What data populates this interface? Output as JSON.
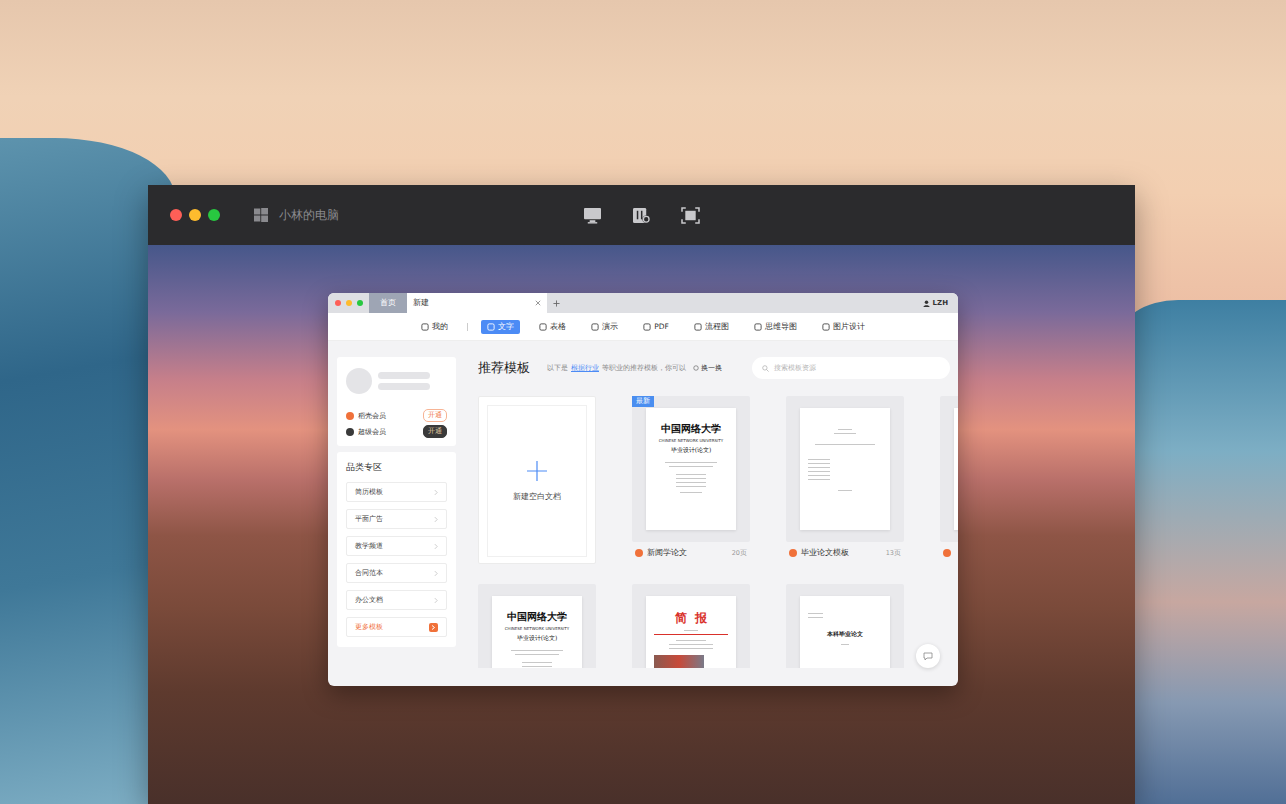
{
  "remote_window": {
    "title": "小林的电脑"
  },
  "app": {
    "tabs": [
      {
        "label": "首页",
        "selected": false
      },
      {
        "label": "新建",
        "selected": true
      }
    ],
    "user": "LZH",
    "toolbar": [
      {
        "label": "我的",
        "selected": false
      },
      {
        "label": "文字",
        "selected": true
      },
      {
        "label": "表格",
        "selected": false
      },
      {
        "label": "演示",
        "selected": false
      },
      {
        "label": "PDF",
        "selected": false
      },
      {
        "label": "流程图",
        "selected": false
      },
      {
        "label": "思维导图",
        "selected": false
      },
      {
        "label": "图片设计",
        "selected": false
      }
    ],
    "sidebar": {
      "members": [
        {
          "name": "稻壳会员",
          "action": "开通",
          "kind": "outline",
          "color": "#f0713a"
        },
        {
          "name": "超级会员",
          "action": "开通",
          "kind": "filled",
          "color": "#3a3a3a"
        }
      ],
      "category_title": "品类专区",
      "categories": [
        {
          "label": "简历模板",
          "kind": "link"
        },
        {
          "label": "平面广告",
          "kind": "link"
        },
        {
          "label": "教学频道",
          "kind": "link"
        },
        {
          "label": "合同范本",
          "kind": "link"
        },
        {
          "label": "办公文档",
          "kind": "link"
        },
        {
          "label": "更多模板",
          "kind": "more"
        }
      ]
    },
    "main": {
      "title": "推荐模板",
      "hint_before": "以下是",
      "hint_link": "根据行业",
      "hint_after": "等职业的推荐模板，你可以",
      "refresh": "换一换",
      "search_placeholder": "搜索模板资源",
      "new_blank": "新建空白文档",
      "templates": [
        {
          "kind": "cover",
          "name": "新闻学论文",
          "pages": "20页",
          "badge": "最新",
          "lines": [
            "中国网络大学",
            "CHINESE NETWORK UNIVERSITY",
            "毕业设计(论文)"
          ]
        },
        {
          "kind": "plain",
          "name": "毕业论文模板",
          "pages": "13页",
          "lines": []
        },
        {
          "kind": "plain",
          "lines": []
        },
        {
          "kind": "cover",
          "lines": [
            "中国网络大学",
            "CHINESE NETWORK UNIVERSITY",
            "毕业设计(论文)"
          ]
        },
        {
          "kind": "report",
          "lines": [
            "简报"
          ]
        },
        {
          "kind": "thesis",
          "lines": [
            "本科毕业论文"
          ]
        }
      ]
    }
  }
}
